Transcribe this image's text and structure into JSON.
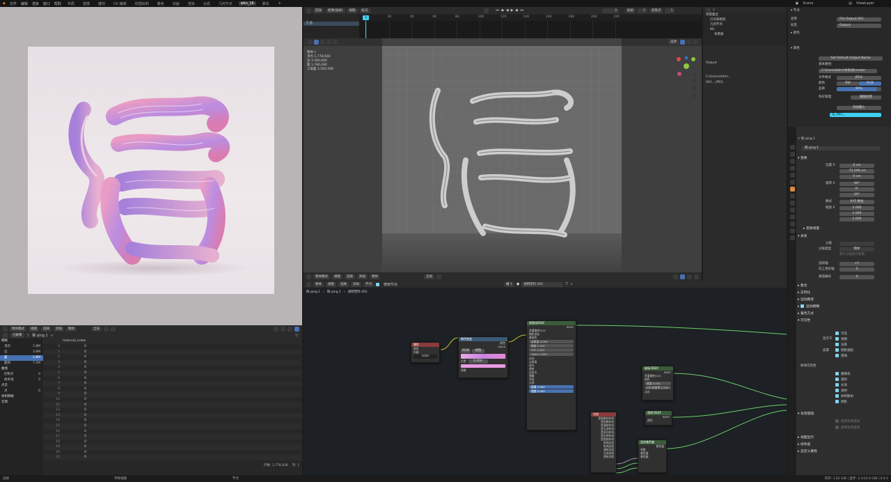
{
  "topbar": {
    "menus": [
      "文件",
      "编辑",
      "渲染",
      "窗口",
      "帮助"
    ],
    "workspaces": [
      "布局",
      "建模",
      "雕刻",
      "UV 编辑",
      "纹理绘制",
      "着色",
      "动画",
      "渲染",
      "合成",
      "几何节点",
      "wkn_16",
      "脚本"
    ],
    "active_workspace": "wkn_16",
    "scene_label": "Scene",
    "viewlayer_label": "ViewLayer"
  },
  "render_footer": {
    "mode": "物体模式",
    "menus": [
      "视图",
      "选择",
      "添加",
      "物体"
    ],
    "view": "全局"
  },
  "spreadsheet": {
    "header": {
      "selected_only": "已解算",
      "object": "碗.qing.1"
    },
    "column": "material_index",
    "tree": [
      {
        "label": "网格",
        "head": true
      },
      {
        "label": "顶点",
        "count": "1.8M"
      },
      {
        "label": "边",
        "count": "3.6M"
      },
      {
        "label": "面",
        "count": "1.8M",
        "selected": true
      },
      {
        "label": "面拐",
        "count": "7.1M"
      },
      {
        "label": "曲线",
        "head": true
      },
      {
        "label": "控制点",
        "count": "0"
      },
      {
        "label": "样条线",
        "count": "0"
      },
      {
        "label": "点云",
        "head": true
      },
      {
        "label": "点",
        "count": "0"
      },
      {
        "label": "体积网格",
        "head": true
      },
      {
        "label": "实例",
        "head": true
      }
    ],
    "rows": [
      [
        "0",
        "0"
      ],
      [
        "1",
        "0"
      ],
      [
        "2",
        "0"
      ],
      [
        "3",
        "0"
      ],
      [
        "4",
        "0"
      ],
      [
        "5",
        "0"
      ],
      [
        "6",
        "0"
      ],
      [
        "7",
        "0"
      ],
      [
        "8",
        "0"
      ],
      [
        "9",
        "0"
      ],
      [
        "10",
        "0"
      ],
      [
        "11",
        "0"
      ],
      [
        "12",
        "0"
      ],
      [
        "13",
        "0"
      ],
      [
        "14",
        "0"
      ],
      [
        "15",
        "0"
      ],
      [
        "16",
        "0"
      ],
      [
        "17",
        "0"
      ],
      [
        "18",
        "0"
      ],
      [
        "19",
        "0"
      ],
      [
        "20",
        "0"
      ],
      [
        "21",
        "0"
      ]
    ],
    "rows_label": "行数: 1,778,928",
    "cols_label": "列: 1"
  },
  "timeline": {
    "menus": [
      "回放",
      "抠像(插帧)",
      "视图",
      "标记"
    ],
    "current_frame": "3",
    "start_label": "起始",
    "start": "1",
    "end_label": "结束点",
    "end": "1",
    "ticks": [
      "0",
      "20",
      "40",
      "60",
      "80",
      "100",
      "120",
      "140",
      "160",
      "180",
      "200",
      "220"
    ],
    "playhead": "3",
    "track_label": "汇总"
  },
  "viewport": {
    "stats": [
      "物体  1",
      "顶点  1,778,928",
      "边  3,560,600",
      "面  1,780,284",
      "三角面 3,560,568"
    ],
    "view_btn": "选项",
    "footer": {
      "mode": "物体模式",
      "menus": [
        "视图",
        "选择",
        "添加",
        "物体"
      ],
      "transform": "全局"
    }
  },
  "nodes": {
    "header": {
      "mode": "物体",
      "menus": [
        "视图",
        "选择",
        "添加",
        "节点"
      ],
      "use_nodes": "使用节点",
      "slot": "槽 1",
      "material": "透明塑料.002"
    },
    "breadcrumb": [
      "碗.qing.1",
      "碗.qing.1",
      "透明塑料.002"
    ],
    "n_attr": {
      "title": "属性",
      "rows": [
        "颜色",
        "向量",
        "系数",
        "Alpha"
      ],
      "field": "color"
    },
    "n_ramp": {
      "title": "颜色渐变",
      "rows": [
        "颜色",
        "Alpha",
        "RGB",
        "线性",
        "位置",
        "系数"
      ],
      "pos": "0.000"
    },
    "n_bsdf": {
      "title": "原理化BSDF",
      "rows": [
        "BSDF",
        "多重散射GGX",
        "随机游走",
        "基础色",
        "金属度 0.000",
        "糙度 0.500",
        "IOR 1.500",
        "Alpha 1.000",
        "法向",
        "次表面",
        "高光",
        "透射",
        "自发光",
        "薄膜",
        "涂层",
        "光泽",
        "权重 1.000",
        "强度 0.000"
      ]
    },
    "n_glass": {
      "title": "玻璃 BSDF",
      "rows": [
        "BSDF",
        "多重散射GGX",
        "颜色",
        "糙度 0.000",
        "IOR 折射率 1.500",
        "法向"
      ]
    },
    "n_trans": {
      "title": "透明 BSDF",
      "rows": [
        "BSDF",
        "颜色"
      ]
    },
    "n_light": {
      "title": "光程",
      "rows": [
        "是摄像机射线",
        "是阴影射线",
        "是漫射射线",
        "是光泽射线",
        "是奇异射线",
        "是反射射线",
        "是透射射线",
        "射线长度",
        "射线深度",
        "漫射深度",
        "光泽深度",
        "透射深度"
      ]
    },
    "n_mix": {
      "title": "混合着色器",
      "rows": [
        "着色器",
        "系数",
        "着色器",
        "着色器"
      ]
    }
  },
  "outliner": {
    "title": "场景集合",
    "items": [
      "灯光和相机",
      "几何节点",
      "BG",
      "背景板"
    ]
  },
  "props_top": {
    "label": "节点",
    "name_label": "名称",
    "name": "File Output.001",
    "label_label": "标签",
    "label_value": "Output",
    "color_label": "颜色",
    "props_label": "属性",
    "default_button": "Set Default Output Name",
    "base_path_label": "基本路径:",
    "base_path": "C:\\Users\\Admi\\本地地\\render",
    "format_label": "文件格式",
    "format": "JPEG",
    "color_mode_label": "颜色",
    "color_modes": [
      "BW",
      "RGB"
    ],
    "quality_label": "品质",
    "quality": "90%",
    "color_mgmt_label": "色彩管理",
    "color_mgmt": "跟随场景",
    "add_input": "添加输入",
    "input": "信_001_",
    "left_items": [
      "Output",
      "C:\\Users\\Admi...",
      "001...  JPEG"
    ]
  },
  "props": {
    "object_name": "碗.qing.1",
    "object_sub": "碗.qing.1",
    "transform_label": "变换",
    "location_label": "位置 X",
    "location": [
      "0 cm",
      "-73.299 cm",
      "0 cm"
    ],
    "rotation_label": "旋转 X",
    "rotation": [
      "90°",
      "0°",
      "20°"
    ],
    "mode_label": "模式",
    "mode": "XYZ 欧拉",
    "scale_label": "缩放 X",
    "scale": [
      "1.000",
      "1.000",
      "1.000"
    ],
    "delta_label": "变换增量",
    "relations_label": "关系",
    "parent_label": "父级",
    "parent_type_label": "父级类型",
    "parent_type": "物体",
    "parent_inverse": "基于父级反向变换",
    "track_label": "追踪轴",
    "track": "+Y",
    "up_label": "向上坐标轴",
    "up": "Z",
    "pass_label": "通道编号",
    "pass": "0",
    "sections": [
      "集合",
      "实例化",
      "运动路径",
      "运动模糊",
      "着色方式",
      "可见性"
    ],
    "vis_display_label": "显示于",
    "vis_items": [
      "可选",
      "视图",
      "渲染"
    ],
    "vis_mask_label": "遮罩",
    "vis_mask": [
      "阴影捕捉",
      "阻隔"
    ],
    "ray_label": "射线可见性",
    "ray_items": [
      "摄像机",
      "漫射",
      "光泽",
      "透射",
      "体积散射",
      "阴影"
    ],
    "light_label": "背景阻隔",
    "light_items": [
      "使用背景阻隔",
      "使用背景阻隔"
    ],
    "bottom_sections": [
      "视图显示",
      "线条画",
      "自定义属性"
    ]
  },
  "statusbar": {
    "left": "选择",
    "mid": "平移视图",
    "right_mid": "节点",
    "right": "内存: 1.62 GiB | 显存: 3.1/12.0 GiB | 4.0.2"
  },
  "colors": {
    "accent": "#4772b3",
    "cyan": "#3ed0f0",
    "node_green": "#6ccf6a",
    "node_link": "#a0a0a0"
  }
}
